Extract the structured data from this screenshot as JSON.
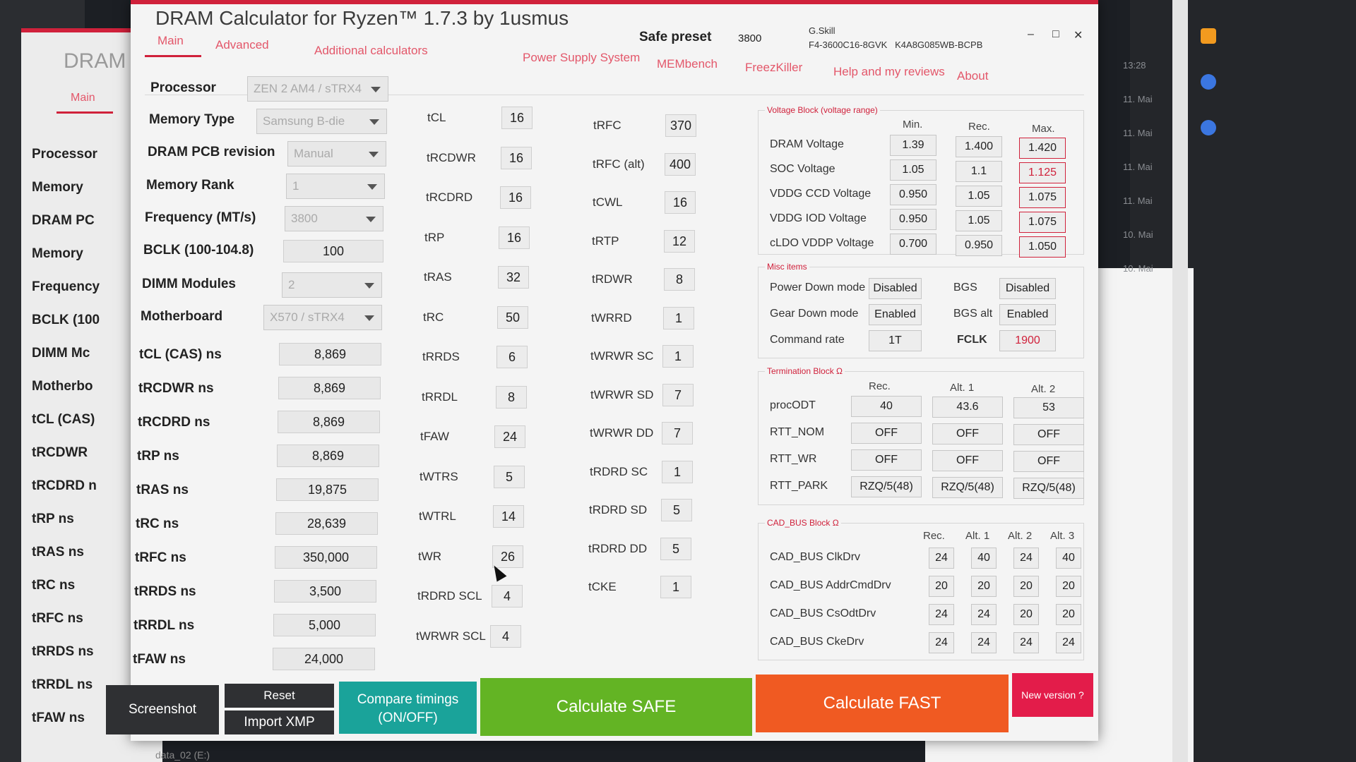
{
  "title": "DRAM Calculator for Ryzen™ 1.7.3 by 1usmus",
  "safe_preset_label": "Safe preset",
  "safe_preset_value": "3800",
  "memory_info": {
    "vendor": "G.Skill",
    "part": "F4-3600C16-8GVK",
    "chip": "K4A8G085WB-BCPB"
  },
  "window_controls": {
    "minimize": "–",
    "maximize": "□",
    "close": "✕"
  },
  "nav": {
    "main": "Main",
    "advanced": "Advanced",
    "additional": "Additional calculators",
    "psu": "Power Supply System",
    "membench": "MEMbench",
    "freezkiller": "FreezKiller",
    "help": "Help and my reviews",
    "about": "About"
  },
  "behind": {
    "title": "DRAM",
    "tab": "Main",
    "items": [
      "Processor",
      "Memory",
      "DRAM PC",
      "Memory",
      "Frequency",
      "BCLK (100",
      "DIMM Mc",
      "Motherbo",
      "tCL (CAS)",
      "tRCDWR",
      "tRCDRD n",
      "tRP ns",
      "tRAS ns",
      "tRC ns",
      "tRFC ns",
      "tRRDS ns",
      "tRRDL ns",
      "tFAW ns"
    ]
  },
  "left": {
    "processor": {
      "label": "Processor",
      "value": "ZEN 2 AM4 / sTRX4"
    },
    "memory_type": {
      "label": "Memory Type",
      "value": "Samsung B-die"
    },
    "pcb": {
      "label": "DRAM PCB revision",
      "value": "Manual"
    },
    "rank": {
      "label": "Memory Rank",
      "value": "1"
    },
    "freq": {
      "label": "Frequency (MT/s)",
      "value": "3800"
    },
    "bclk": {
      "label": "BCLK (100-104.8)",
      "value": "100"
    },
    "dimm": {
      "label": "DIMM Modules",
      "value": "2"
    },
    "mobo": {
      "label": "Motherboard",
      "value": "X570 / sTRX4"
    },
    "ns": [
      {
        "label": "tCL (CAS) ns",
        "value": "8,869"
      },
      {
        "label": "tRCDWR ns",
        "value": "8,869"
      },
      {
        "label": "tRCDRD ns",
        "value": "8,869"
      },
      {
        "label": "tRP ns",
        "value": "8,869"
      },
      {
        "label": "tRAS ns",
        "value": "19,875"
      },
      {
        "label": "tRC ns",
        "value": "28,639"
      },
      {
        "label": "tRFC ns",
        "value": "350,000"
      },
      {
        "label": "tRRDS ns",
        "value": "3,500"
      },
      {
        "label": "tRRDL ns",
        "value": "5,000"
      },
      {
        "label": "tFAW ns",
        "value": "24,000"
      }
    ]
  },
  "timings1": [
    {
      "label": "tCL",
      "value": "16"
    },
    {
      "label": "tRCDWR",
      "value": "16"
    },
    {
      "label": "tRCDRD",
      "value": "16"
    },
    {
      "label": "tRP",
      "value": "16"
    },
    {
      "label": "tRAS",
      "value": "32"
    },
    {
      "label": "tRC",
      "value": "50"
    },
    {
      "label": "tRRDS",
      "value": "6"
    },
    {
      "label": "tRRDL",
      "value": "8"
    },
    {
      "label": "tFAW",
      "value": "24"
    },
    {
      "label": "tWTRS",
      "value": "5"
    },
    {
      "label": "tWTRL",
      "value": "14"
    },
    {
      "label": "tWR",
      "value": "26"
    },
    {
      "label": "tRDRD SCL",
      "value": "4"
    },
    {
      "label": "tWRWR SCL",
      "value": "4"
    }
  ],
  "timings2": [
    {
      "label": "tRFC",
      "value": "370"
    },
    {
      "label": "tRFC (alt)",
      "value": "400"
    },
    {
      "label": "tCWL",
      "value": "16"
    },
    {
      "label": "tRTP",
      "value": "12"
    },
    {
      "label": "tRDWR",
      "value": "8"
    },
    {
      "label": "tWRRD",
      "value": "1"
    },
    {
      "label": "tWRWR SC",
      "value": "1"
    },
    {
      "label": "tWRWR SD",
      "value": "7"
    },
    {
      "label": "tWRWR DD",
      "value": "7"
    },
    {
      "label": "tRDRD SC",
      "value": "1"
    },
    {
      "label": "tRDRD SD",
      "value": "5"
    },
    {
      "label": "tRDRD DD",
      "value": "5"
    },
    {
      "label": "tCKE",
      "value": "1"
    }
  ],
  "voltage": {
    "title": "Voltage Block (voltage range)",
    "headers": [
      "Min.",
      "Rec.",
      "Max."
    ],
    "rows": [
      {
        "label": "DRAM Voltage",
        "min": "1.39",
        "rec": "1.400",
        "max": "1.420"
      },
      {
        "label": "SOC Voltage",
        "min": "1.05",
        "rec": "1.1",
        "max": "1.125"
      },
      {
        "label": "VDDG  CCD Voltage",
        "min": "0.950",
        "rec": "1.05",
        "max": "1.075"
      },
      {
        "label": "VDDG  IOD Voltage",
        "min": "0.950",
        "rec": "1.05",
        "max": "1.075"
      },
      {
        "label": "cLDO VDDP Voltage",
        "min": "0.700",
        "rec": "0.950",
        "max": "1.050"
      }
    ]
  },
  "misc": {
    "title": "Misc items",
    "power_down": {
      "label": "Power Down mode",
      "value": "Disabled"
    },
    "bgs": {
      "label": "BGS",
      "value": "Disabled"
    },
    "gear_down": {
      "label": "Gear Down mode",
      "value": "Enabled"
    },
    "bgs_alt": {
      "label": "BGS alt",
      "value": "Enabled"
    },
    "cmd_rate": {
      "label": "Command rate",
      "value": "1T"
    },
    "fclk": {
      "label": "FCLK",
      "value": "1900"
    }
  },
  "termination": {
    "title": "Termination Block Ω",
    "headers": [
      "Rec.",
      "Alt. 1",
      "Alt. 2"
    ],
    "rows": [
      {
        "label": "procODT",
        "v": [
          "40",
          "43.6",
          "53"
        ]
      },
      {
        "label": "RTT_NOM",
        "v": [
          "OFF",
          "OFF",
          "OFF"
        ]
      },
      {
        "label": "RTT_WR",
        "v": [
          "OFF",
          "OFF",
          "OFF"
        ]
      },
      {
        "label": "RTT_PARK",
        "v": [
          "RZQ/5(48)",
          "RZQ/5(48)",
          "RZQ/5(48)"
        ]
      }
    ]
  },
  "cadbus": {
    "title": "CAD_BUS Block Ω",
    "headers": [
      "Rec.",
      "Alt. 1",
      "Alt. 2",
      "Alt. 3"
    ],
    "rows": [
      {
        "label": "CAD_BUS ClkDrv",
        "v": [
          "24",
          "40",
          "24",
          "40"
        ]
      },
      {
        "label": "CAD_BUS AddrCmdDrv",
        "v": [
          "20",
          "20",
          "20",
          "20"
        ]
      },
      {
        "label": "CAD_BUS CsOdtDrv",
        "v": [
          "24",
          "24",
          "20",
          "20"
        ]
      },
      {
        "label": "CAD_BUS CkeDrv",
        "v": [
          "24",
          "24",
          "24",
          "24"
        ]
      }
    ]
  },
  "buttons": {
    "screenshot": "Screenshot",
    "reset": "Reset",
    "import_xmp": "Import XMP",
    "compare_1": "Compare timings",
    "compare_2": "(ON/OFF)",
    "calc_safe": "Calculate SAFE",
    "calc_fast": "Calculate FAST",
    "new_version": "New version ?"
  },
  "desktop": {
    "times": [
      "13:28",
      "11. Mai",
      "11. Mai",
      "11. Mai",
      "11. Mai",
      "10. Mai",
      "10. Mai"
    ],
    "bottom": "data_02 (E:)"
  }
}
